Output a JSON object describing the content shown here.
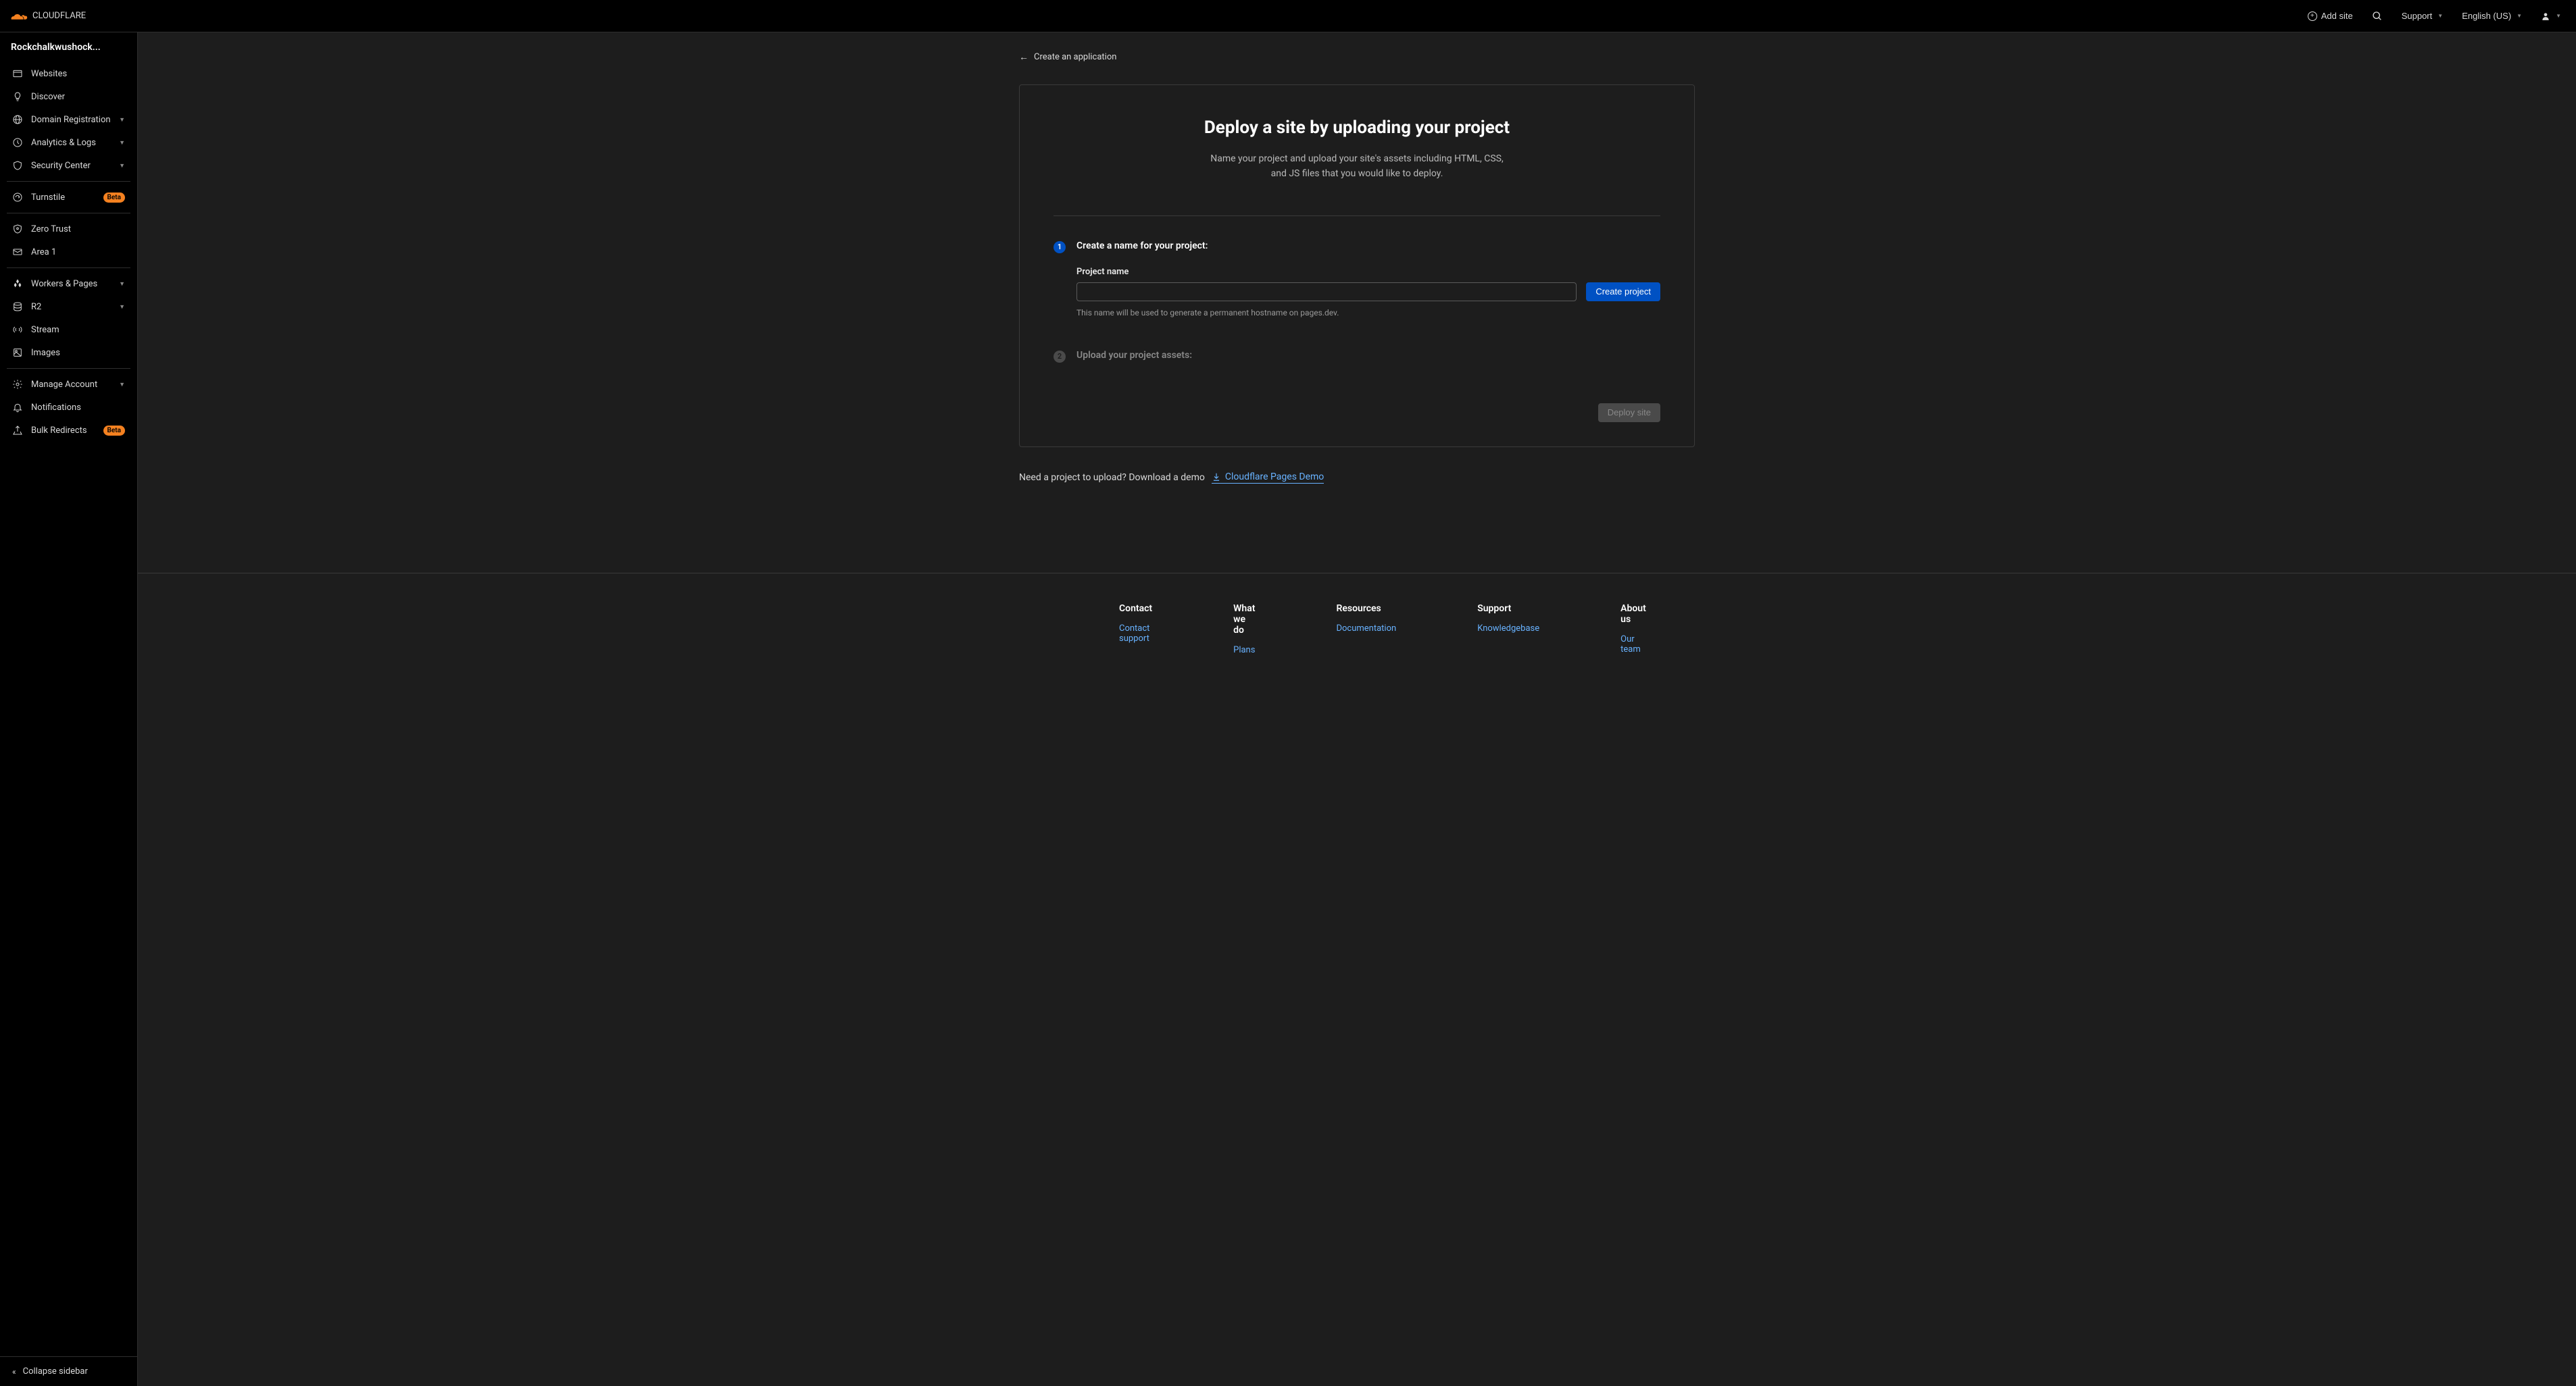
{
  "header": {
    "logo_text": "CLOUDFLARE",
    "add_site": "Add site",
    "support": "Support",
    "language": "English (US)"
  },
  "sidebar": {
    "account": "Rockchalkwushock...",
    "items": [
      {
        "label": "Websites",
        "icon": "window-icon",
        "expand": false
      },
      {
        "label": "Discover",
        "icon": "bulb-icon",
        "expand": false
      },
      {
        "label": "Domain Registration",
        "icon": "globe-icon",
        "expand": true
      },
      {
        "label": "Analytics & Logs",
        "icon": "analytics-icon",
        "expand": true
      },
      {
        "label": "Security Center",
        "icon": "shield-icon",
        "expand": true
      }
    ],
    "items2": [
      {
        "label": "Turnstile",
        "icon": "turnstile-icon",
        "beta": true
      }
    ],
    "items3": [
      {
        "label": "Zero Trust",
        "icon": "zero-trust-icon"
      },
      {
        "label": "Area 1",
        "icon": "mail-icon"
      }
    ],
    "items4": [
      {
        "label": "Workers & Pages",
        "icon": "workers-icon",
        "expand": true
      },
      {
        "label": "R2",
        "icon": "storage-icon",
        "expand": true
      },
      {
        "label": "Stream",
        "icon": "stream-icon"
      },
      {
        "label": "Images",
        "icon": "images-icon"
      }
    ],
    "items5": [
      {
        "label": "Manage Account",
        "icon": "gear-icon",
        "expand": true
      },
      {
        "label": "Notifications",
        "icon": "bell-icon"
      },
      {
        "label": "Bulk Redirects",
        "icon": "redirect-icon",
        "beta": true
      }
    ],
    "collapse": "Collapse sidebar",
    "beta_label": "Beta"
  },
  "main": {
    "back": "Create an application",
    "title": "Deploy a site by uploading your project",
    "subtitle": "Name your project and upload your site's assets including HTML, CSS, and JS files that you would like to deploy.",
    "step1_title": "Create a name for your project:",
    "project_name_label": "Project name",
    "project_name_value": "",
    "create_btn": "Create project",
    "project_name_help": "This name will be used to generate a permanent hostname on pages.dev.",
    "step2_title": "Upload your project assets:",
    "deploy_btn": "Deploy site",
    "demo_text": "Need a project to upload? Download a demo",
    "demo_link": "Cloudflare Pages Demo"
  },
  "footer": {
    "cols": [
      {
        "title": "Contact",
        "links": [
          "Contact support"
        ]
      },
      {
        "title": "What we do",
        "links": [
          "Plans"
        ]
      },
      {
        "title": "Resources",
        "links": [
          "Documentation"
        ]
      },
      {
        "title": "Support",
        "links": [
          "Knowledgebase"
        ]
      },
      {
        "title": "About us",
        "links": [
          "Our team"
        ]
      }
    ]
  }
}
